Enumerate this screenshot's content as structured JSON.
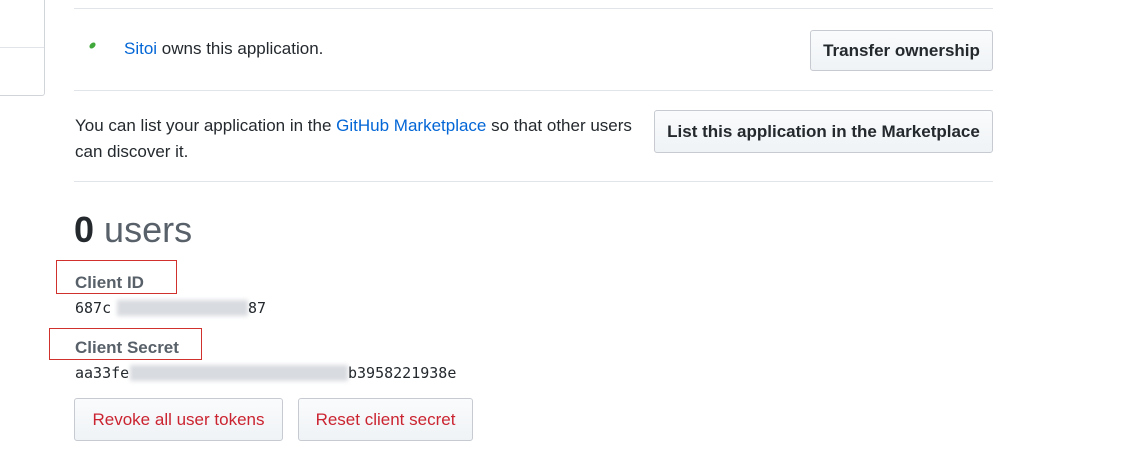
{
  "ownership": {
    "owner_name": "Sitoi",
    "owns_text": " owns this application.",
    "transfer_button": "Transfer ownership"
  },
  "marketplace": {
    "text_before": "You can list your application in the ",
    "link_text": "GitHub Marketplace",
    "text_after": " so that other users can discover it.",
    "list_button": "List this application in the Marketplace"
  },
  "users": {
    "count": "0",
    "label": "users"
  },
  "client_id": {
    "label": "Client ID",
    "visible_start": "687c",
    "visible_end": "87"
  },
  "client_secret": {
    "label": "Client Secret",
    "visible_start": "aa33fe",
    "visible_end": "b3958221938e"
  },
  "actions": {
    "revoke_button": "Revoke all user tokens",
    "reset_button": "Reset client secret"
  },
  "colors": {
    "link": "#0366d6",
    "danger": "#cb2431",
    "highlight": "#d0312d"
  }
}
